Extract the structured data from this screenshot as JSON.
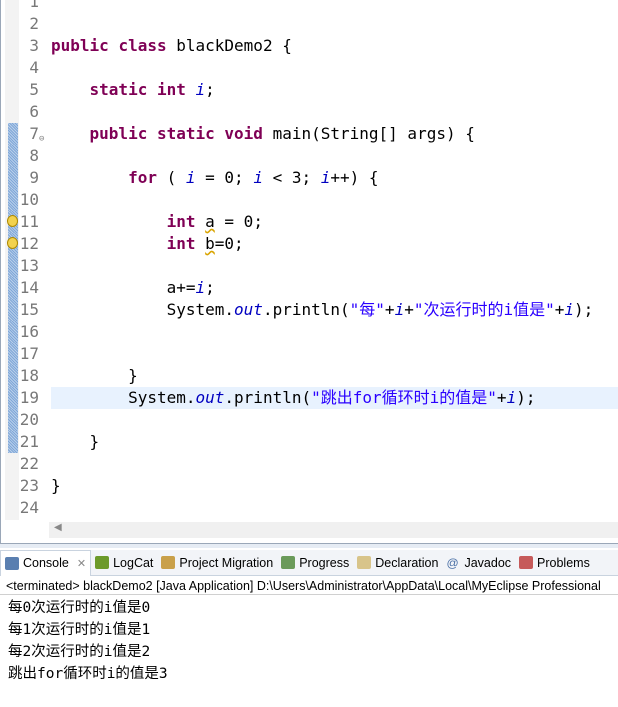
{
  "editor": {
    "first_line": 1,
    "current_line": 19,
    "changed_lines": [
      7,
      8,
      9,
      10,
      11,
      12,
      13,
      14,
      15,
      16,
      17,
      18,
      19,
      20,
      21
    ],
    "warning_lines": [
      11,
      12
    ],
    "fold_lines": [
      7
    ],
    "lines": [
      [],
      [],
      [
        {
          "t": "public",
          "c": "kw"
        },
        {
          "t": " "
        },
        {
          "t": "class",
          "c": "kw"
        },
        {
          "t": " blackDemo2 {"
        }
      ],
      [],
      [
        {
          "t": "    "
        },
        {
          "t": "static",
          "c": "kw"
        },
        {
          "t": " "
        },
        {
          "t": "int",
          "c": "kw"
        },
        {
          "t": " "
        },
        {
          "t": "i",
          "c": "fld"
        },
        {
          "t": ";"
        }
      ],
      [],
      [
        {
          "t": "    "
        },
        {
          "t": "public",
          "c": "kw"
        },
        {
          "t": " "
        },
        {
          "t": "static",
          "c": "kw"
        },
        {
          "t": " "
        },
        {
          "t": "void",
          "c": "kw"
        },
        {
          "t": " main(String[] args) {"
        }
      ],
      [],
      [
        {
          "t": "        "
        },
        {
          "t": "for",
          "c": "kw"
        },
        {
          "t": " ( "
        },
        {
          "t": "i",
          "c": "fld"
        },
        {
          "t": " = 0; "
        },
        {
          "t": "i",
          "c": "fld"
        },
        {
          "t": " < 3; "
        },
        {
          "t": "i",
          "c": "fld"
        },
        {
          "t": "++) {"
        }
      ],
      [],
      [
        {
          "t": "            "
        },
        {
          "t": "int",
          "c": "kw"
        },
        {
          "t": " "
        },
        {
          "t": "a",
          "c": "warn"
        },
        {
          "t": " = 0;"
        }
      ],
      [
        {
          "t": "            "
        },
        {
          "t": "int",
          "c": "kw"
        },
        {
          "t": " "
        },
        {
          "t": "b",
          "c": "warn"
        },
        {
          "t": "=0;"
        }
      ],
      [],
      [
        {
          "t": "            a+="
        },
        {
          "t": "i",
          "c": "fld"
        },
        {
          "t": ";"
        }
      ],
      [
        {
          "t": "            System."
        },
        {
          "t": "out",
          "c": "st"
        },
        {
          "t": ".println("
        },
        {
          "t": "\"每\"",
          "c": "str"
        },
        {
          "t": "+"
        },
        {
          "t": "i",
          "c": "fld"
        },
        {
          "t": "+"
        },
        {
          "t": "\"次运行时的i值是\"",
          "c": "str"
        },
        {
          "t": "+"
        },
        {
          "t": "i",
          "c": "fld"
        },
        {
          "t": ");"
        }
      ],
      [],
      [],
      [
        {
          "t": "        }"
        }
      ],
      [
        {
          "t": "        System."
        },
        {
          "t": "out",
          "c": "st"
        },
        {
          "t": ".println("
        },
        {
          "t": "\"跳出for循环时i的值是\"",
          "c": "str"
        },
        {
          "t": "+"
        },
        {
          "t": "i",
          "c": "fld"
        },
        {
          "t": ");"
        }
      ],
      [],
      [
        {
          "t": "    }"
        }
      ],
      [],
      [
        {
          "t": "}"
        }
      ],
      []
    ]
  },
  "panel": {
    "tabs": [
      {
        "label": "Console",
        "icon": "console-icon",
        "active": true
      },
      {
        "label": "LogCat",
        "icon": "logcat-icon"
      },
      {
        "label": "Project Migration",
        "icon": "project-migration-icon"
      },
      {
        "label": "Progress",
        "icon": "progress-icon"
      },
      {
        "label": "Declaration",
        "icon": "declaration-icon"
      },
      {
        "label": "Javadoc",
        "icon": "javadoc-icon"
      },
      {
        "label": "Problems",
        "icon": "problems-icon"
      }
    ],
    "close_label": "✕",
    "status": "<terminated> blackDemo2 [Java Application] D:\\Users\\Administrator\\AppData\\Local\\MyEclipse Professional",
    "output": [
      "每0次运行时的i值是0",
      "每1次运行时的i值是1",
      "每2次运行时的i值是2",
      "跳出for循环时i的值是3"
    ]
  }
}
